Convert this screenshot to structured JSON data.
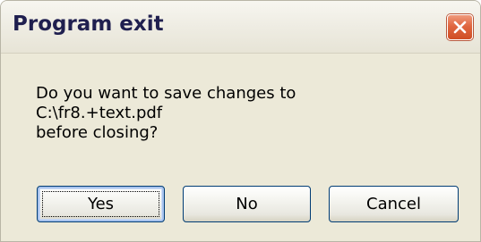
{
  "dialog": {
    "title": "Program exit",
    "message_lines": [
      "Do you want to save changes to",
      "C:\\fr8.+text.pdf",
      "before closing?"
    ],
    "buttons": {
      "yes": "Yes",
      "no": "No",
      "cancel": "Cancel"
    }
  },
  "icons": {
    "close": "close-icon"
  },
  "colors": {
    "title_text": "#1f1f4f",
    "close_button": "#e06741",
    "dialog_background": "#ece9d8",
    "button_border": "#003c74"
  }
}
